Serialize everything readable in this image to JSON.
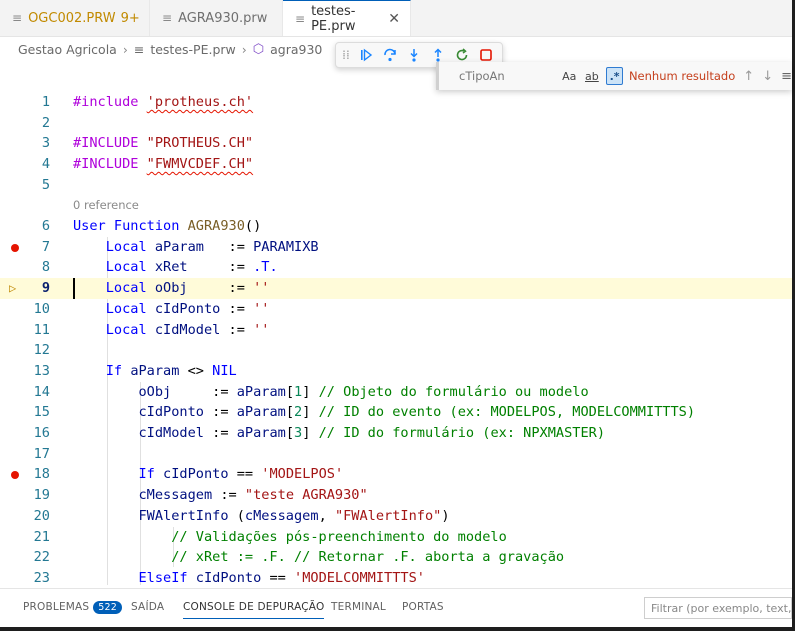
{
  "tabs": [
    {
      "label": "OGC002.PRW",
      "badge": "9+",
      "active": false
    },
    {
      "label": "AGRA930.prw",
      "active": false
    },
    {
      "label": "testes-PE.prw",
      "active": true
    }
  ],
  "breadcrumb": [
    "Gestao Agricola",
    "testes-PE.prw",
    "agra930"
  ],
  "find": {
    "query": "cTipoAn",
    "match_case": "Aa",
    "whole_word": "ab",
    "regex": ".*",
    "result": "Nenhum resultado"
  },
  "editor": {
    "codelens": "0 reference",
    "lines": [
      {
        "n": "1"
      },
      {
        "n": "2"
      },
      {
        "n": "3"
      },
      {
        "n": "4"
      },
      {
        "n": "5"
      },
      {
        "n": "6"
      },
      {
        "n": "7"
      },
      {
        "n": "8"
      },
      {
        "n": "9"
      },
      {
        "n": "10"
      },
      {
        "n": "11"
      },
      {
        "n": "12"
      },
      {
        "n": "13"
      },
      {
        "n": "14"
      },
      {
        "n": "15"
      },
      {
        "n": "16"
      },
      {
        "n": "17"
      },
      {
        "n": "18"
      },
      {
        "n": "19"
      },
      {
        "n": "20"
      },
      {
        "n": "21"
      },
      {
        "n": "22"
      },
      {
        "n": "23"
      }
    ],
    "code": {
      "l1_a": "#include",
      "l1_b": "'protheus.ch'",
      "l3_a": "#INCLUDE",
      "l3_b": "\"PROTHEUS.CH\"",
      "l4_a": "#INCLUDE",
      "l4_b": "\"FWMVCDEF.CH\"",
      "l6_a": "User Function",
      "l6_b": "AGRA930",
      "l6_c": "()",
      "l7_a": "Local",
      "l7_b": "aParam",
      "l7_c": ":=",
      "l7_d": "PARAMIXB",
      "l8_a": "Local",
      "l8_b": "xRet",
      "l8_c": ":=",
      "l8_d": ".T.",
      "l9_a": "Local",
      "l9_b": "oObj",
      "l9_c": ":=",
      "l9_d": "''",
      "l10_a": "Local",
      "l10_b": "cIdPonto",
      "l10_c": ":=",
      "l10_d": "''",
      "l11_a": "Local",
      "l11_b": "cIdModel",
      "l11_c": ":=",
      "l11_d": "''",
      "l13_a": "If",
      "l13_b": "aParam",
      "l13_c": "<>",
      "l13_d": "NIL",
      "l14_a": "oObj",
      "l14_b": ":=",
      "l14_c": "aParam",
      "l14_d": "[",
      "l14_e": "1",
      "l14_f": "]",
      "l14_g": "// Objeto do formulário ou modelo",
      "l15_a": "cIdPonto",
      "l15_b": ":=",
      "l15_c": "aParam",
      "l15_d": "[",
      "l15_e": "2",
      "l15_f": "]",
      "l15_g": "// ID do evento (ex: MODELPOS, MODELCOMMITTTS)",
      "l16_a": "cIdModel",
      "l16_b": ":=",
      "l16_c": "aParam",
      "l16_d": "[",
      "l16_e": "3",
      "l16_f": "]",
      "l16_g": "// ID do formulário (ex: NPXMASTER)",
      "l18_a": "If",
      "l18_b": "cIdPonto",
      "l18_c": "==",
      "l18_d": "'MODELPOS'",
      "l19_a": "cMessagem",
      "l19_b": ":=",
      "l19_c": "\"teste AGRA930\"",
      "l20_a": "FWAlertInfo",
      "l20_b": "(",
      "l20_c": "cMessagem",
      "l20_d": ",",
      "l20_e": "\"FWAlertInfo\"",
      "l20_f": ")",
      "l21": "// Validações pós-preenchimento do modelo",
      "l22": "// xRet := .F. // Retornar .F. aborta a gravação",
      "l23_a": "ElseIf",
      "l23_b": "cIdPonto",
      "l23_c": "==",
      "l23_d": "'MODELCOMMITTTS'"
    }
  },
  "panel": {
    "tabs": [
      "PROBLEMAS",
      "SAÍDA",
      "CONSOLE DE DEPURAÇÃO",
      "TERMINAL",
      "PORTAS"
    ],
    "problems_count": "522",
    "filter_placeholder": "Filtrar (por exemplo, text, !exclude)"
  },
  "colors": {
    "accent": "#005fb8",
    "breakpoint": "#e51400",
    "current_line": "#fffbd9"
  }
}
